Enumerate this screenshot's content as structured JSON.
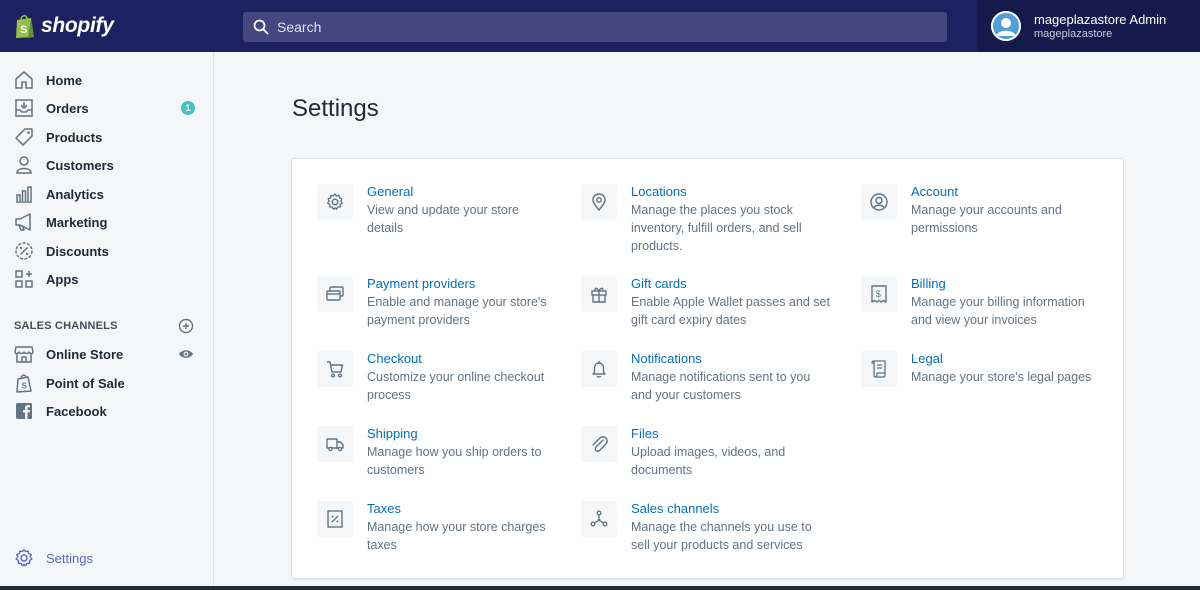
{
  "brand": {
    "name": "shopify"
  },
  "search": {
    "placeholder": "Search"
  },
  "user": {
    "name": "mageplazastore Admin",
    "store": "mageplazastore"
  },
  "sidebar": {
    "items": [
      {
        "label": "Home",
        "icon": "home-icon"
      },
      {
        "label": "Orders",
        "icon": "orders-icon",
        "badge": "1"
      },
      {
        "label": "Products",
        "icon": "tag-icon"
      },
      {
        "label": "Customers",
        "icon": "person-icon"
      },
      {
        "label": "Analytics",
        "icon": "bar-chart-icon"
      },
      {
        "label": "Marketing",
        "icon": "megaphone-icon"
      },
      {
        "label": "Discounts",
        "icon": "discount-icon"
      },
      {
        "label": "Apps",
        "icon": "apps-icon"
      }
    ],
    "channels_title": "SALES CHANNELS",
    "channels": [
      {
        "label": "Online Store",
        "icon": "store-icon"
      },
      {
        "label": "Point of Sale",
        "icon": "pos-icon"
      },
      {
        "label": "Facebook",
        "icon": "facebook-icon"
      }
    ],
    "settings_label": "Settings"
  },
  "page": {
    "title": "Settings"
  },
  "settings": [
    {
      "title": "General",
      "desc": "View and update your store details",
      "icon": "gear-icon"
    },
    {
      "title": "Locations",
      "desc": "Manage the places you stock inventory, fulfill orders, and sell products.",
      "icon": "location-icon"
    },
    {
      "title": "Account",
      "desc": "Manage your accounts and permissions",
      "icon": "account-icon"
    },
    {
      "title": "Payment providers",
      "desc": "Enable and manage your store's payment providers",
      "icon": "payment-icon"
    },
    {
      "title": "Gift cards",
      "desc": "Enable Apple Wallet passes and set gift card expiry dates",
      "icon": "gift-icon"
    },
    {
      "title": "Billing",
      "desc": "Manage your billing information and view your invoices",
      "icon": "billing-icon"
    },
    {
      "title": "Checkout",
      "desc": "Customize your online checkout process",
      "icon": "cart-icon"
    },
    {
      "title": "Notifications",
      "desc": "Manage notifications sent to you and your customers",
      "icon": "bell-icon"
    },
    {
      "title": "Legal",
      "desc": "Manage your store's legal pages",
      "icon": "legal-icon"
    },
    {
      "title": "Shipping",
      "desc": "Manage how you ship orders to customers",
      "icon": "truck-icon"
    },
    {
      "title": "Files",
      "desc": "Upload images, videos, and documents",
      "icon": "paperclip-icon"
    },
    {
      "title": "Taxes",
      "desc": "Manage how your store charges taxes",
      "icon": "tax-icon"
    },
    {
      "title": "Sales channels",
      "desc": "Manage the channels you use to sell your products and services",
      "icon": "channels-icon"
    }
  ]
}
